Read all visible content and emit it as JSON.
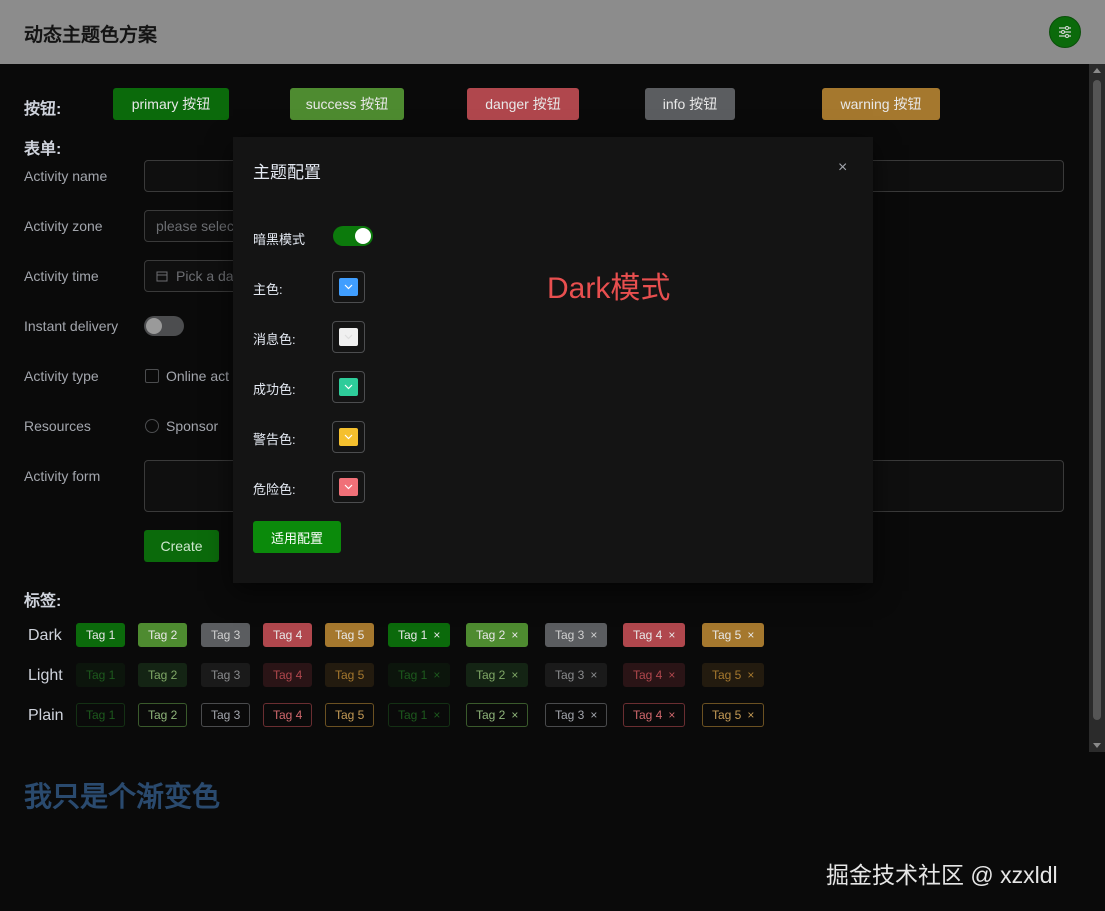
{
  "header": {
    "title": "动态主题色方案"
  },
  "buttons_section": {
    "label": "按钮:",
    "buttons": [
      {
        "label": "primary 按钮",
        "bg": "#0b6a0b"
      },
      {
        "label": "success 按钮",
        "bg": "#4e8b30"
      },
      {
        "label": "danger 按钮",
        "bg": "#b0474d"
      },
      {
        "label": "info 按钮",
        "bg": "#5b5d60"
      },
      {
        "label": "warning 按钮",
        "bg": "#a5782e"
      }
    ]
  },
  "form": {
    "label": "表单:",
    "activity_name": {
      "label": "Activity name",
      "value": ""
    },
    "activity_zone": {
      "label": "Activity zone",
      "placeholder": "please selec"
    },
    "activity_time": {
      "label": "Activity time",
      "placeholder": "Pick a da"
    },
    "instant_delivery": {
      "label": "Instant delivery",
      "on": false
    },
    "activity_type": {
      "label": "Activity type",
      "option": "Online act"
    },
    "resources": {
      "label": "Resources",
      "option": "Sponsor"
    },
    "activity_form": {
      "label": "Activity form",
      "value": ""
    },
    "create_label": "Create"
  },
  "tags": {
    "label": "标签:",
    "rows": [
      {
        "name": "Dark",
        "labels": [
          "Tag 1",
          "Tag 2",
          "Tag 3",
          "Tag 4",
          "Tag 5",
          "Tag 1",
          "Tag 2",
          "Tag 3",
          "Tag 4",
          "Tag 5"
        ]
      },
      {
        "name": "Light",
        "labels": [
          "Tag 1",
          "Tag 2",
          "Tag 3",
          "Tag 4",
          "Tag 5",
          "Tag 1",
          "Tag 2",
          "Tag 3",
          "Tag 4",
          "Tag 5"
        ]
      },
      {
        "name": "Plain",
        "labels": [
          "Tag 1",
          "Tag 2",
          "Tag 3",
          "Tag 4",
          "Tag 5",
          "Tag 1",
          "Tag 2",
          "Tag 3",
          "Tag 4",
          "Tag 5"
        ]
      }
    ],
    "close_glyph": "×"
  },
  "gradient_text": "我只是个渐变色",
  "watermark": "掘金技术社区 @ xzxldl",
  "modal": {
    "title": "主题配置",
    "close_glyph": "×",
    "dark_mode": {
      "label": "暗黑模式",
      "on": true
    },
    "colors": [
      {
        "label": "主色:",
        "color": "#409eff"
      },
      {
        "label": "消息色:",
        "color": "#f0f0f0"
      },
      {
        "label": "成功色:",
        "color": "#2ecc9a"
      },
      {
        "label": "警告色:",
        "color": "#f5c02e"
      },
      {
        "label": "危险色:",
        "color": "#f07078"
      }
    ],
    "apply_label": "适用配置",
    "note": "Dark模式"
  },
  "colors": {
    "accent": "#0b8a0b"
  }
}
